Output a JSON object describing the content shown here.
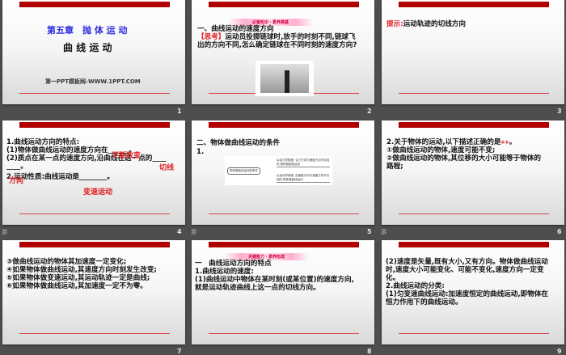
{
  "slides": [
    {
      "number": "1",
      "chapter": "第五章　抛 体 运 动",
      "title": "曲 线 运 动",
      "footer": "第一PPT模板网-WWW.1PPT.COM"
    },
    {
      "number": "2",
      "banner": "必备知识・素养奠基",
      "heading": "一、曲线运动的速度方向",
      "think_label": "【思考】",
      "think_text_1": "运动员投掷链球时,放手的时刻不同,链球飞",
      "think_text_2": "出的方向不同,怎么确定链球在不同时刻的速度方向?"
    },
    {
      "number": "3",
      "hint_label": "提示:",
      "hint_text": "运动轨迹的切线方向"
    },
    {
      "number": "4",
      "line1": "1.曲线运动方向的特点:",
      "line2": "(1)物体做曲线运动的速度方向在______。",
      "line3": "(2)质点在某一点的速度方向,沿曲线在这一点的____",
      "line4": "____。",
      "line5": "2.运动性质:曲线运动是________。",
      "ans1": "不断改变",
      "ans2": "切线",
      "ans3": "方向",
      "ans4": "变速运动",
      "transition": "游"
    },
    {
      "number": "5",
      "heading": "二、物体做曲线运动的条件",
      "sub": "1.",
      "diagram_center": "物体做曲线运动的条件",
      "diagram_top": "从动力学角度: 合力方向与速度方向不共线时,物体做曲线运动",
      "diagram_bottom": "从运动学角度: 加速度方向与速度方向不共线时,物体做曲线运动",
      "transition": "游"
    },
    {
      "number": "6",
      "line1": "2.关于物体的运动,以下描述正确的是",
      "answer": "⑥⑥",
      "line1_end": "。",
      "line2": "①做曲线运动的物体,速度可能不变;",
      "line3": "②做曲线运动的物体,其位移的大小可能等于物体的",
      "line4": "路程;",
      "transition": "游"
    },
    {
      "number": "7",
      "line1": "③做曲线运动的物体其加速度一定变化;",
      "line2": "④如果物体做曲线运动,其速度方向时刻发生改变;",
      "line3": "⑤如果物体做变速运动,其运动轨迹一定是曲线;",
      "line4": "⑥如果物体做曲线运动,其加速度一定不为零。"
    },
    {
      "number": "8",
      "banner": "关键能力・素养形成",
      "line1": "一　曲线运动方向的特点",
      "line2": "1.曲线运动的速度:",
      "line3": "(1)曲线运动中物体在某时刻(或某位置)的速度方向,",
      "line4": "就是运动轨迹曲线上这一点的切线方向。"
    },
    {
      "number": "9",
      "line1": "(2)速度是矢量,既有大小,又有方向。物体做曲线运动",
      "line2": "时,速度大小可能变化、可能不变化,速度方向一定变",
      "line3": "化。",
      "line4": "2.曲线运动的分类:",
      "line5": "(1)匀变速曲线运动:加速度恒定的曲线运动,即物体在",
      "line6": "恒力作用下的曲线运动。"
    }
  ]
}
